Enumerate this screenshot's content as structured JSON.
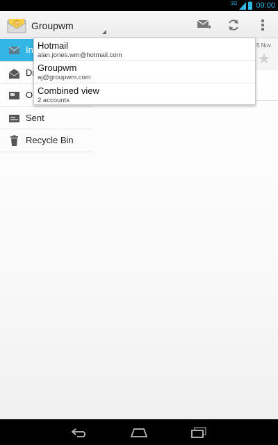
{
  "status_bar": {
    "network": "3G",
    "time": "09:00"
  },
  "action_bar": {
    "account_name": "Groupwm",
    "icons": {
      "app": "email-app-icon",
      "compose": "compose-icon",
      "refresh": "refresh-icon",
      "overflow": "overflow-menu-icon"
    }
  },
  "folders": [
    {
      "label": "Inbox",
      "visible_label": "In",
      "icon": "inbox-icon",
      "selected": true
    },
    {
      "label": "Drafts",
      "visible_label": "Dr",
      "icon": "drafts-icon",
      "selected": false
    },
    {
      "label": "Outbox",
      "visible_label": "Ou",
      "icon": "outbox-icon",
      "selected": false
    },
    {
      "label": "Sent",
      "visible_label": "Sent",
      "icon": "sent-icon",
      "selected": false
    },
    {
      "label": "Recycle Bin",
      "visible_label": "Recycle Bin",
      "icon": "trash-icon",
      "selected": false
    }
  ],
  "message": {
    "date": "5 Nov"
  },
  "account_dropdown": [
    {
      "name": "Hotmail",
      "detail": "alan.jones.wm@hotmail.com"
    },
    {
      "name": "Groupwm",
      "detail": "aj@groupwm.com"
    },
    {
      "name": "Combined view",
      "detail": "2 accounts"
    }
  ],
  "colors": {
    "accent": "#33b5e5",
    "status_bar_bg": "#000000",
    "nav_bar_bg": "#000000"
  }
}
